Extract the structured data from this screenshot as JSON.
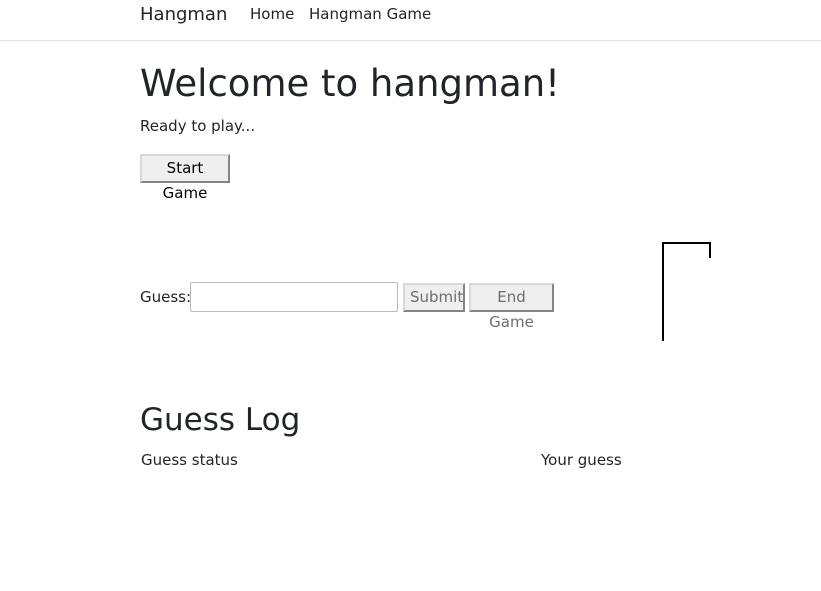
{
  "nav": {
    "brand": "Hangman",
    "links": [
      "Home",
      "Hangman Game"
    ]
  },
  "main": {
    "title": "Welcome to hangman!",
    "status": "Ready to play...",
    "start_button": "Start Game",
    "guess_label": "Guess:",
    "guess_value": "",
    "submit_button": "Submit",
    "end_button": "End Game"
  },
  "guess_log": {
    "title": "Guess Log",
    "columns": [
      "Guess status",
      "Your guess"
    ],
    "rows": []
  }
}
